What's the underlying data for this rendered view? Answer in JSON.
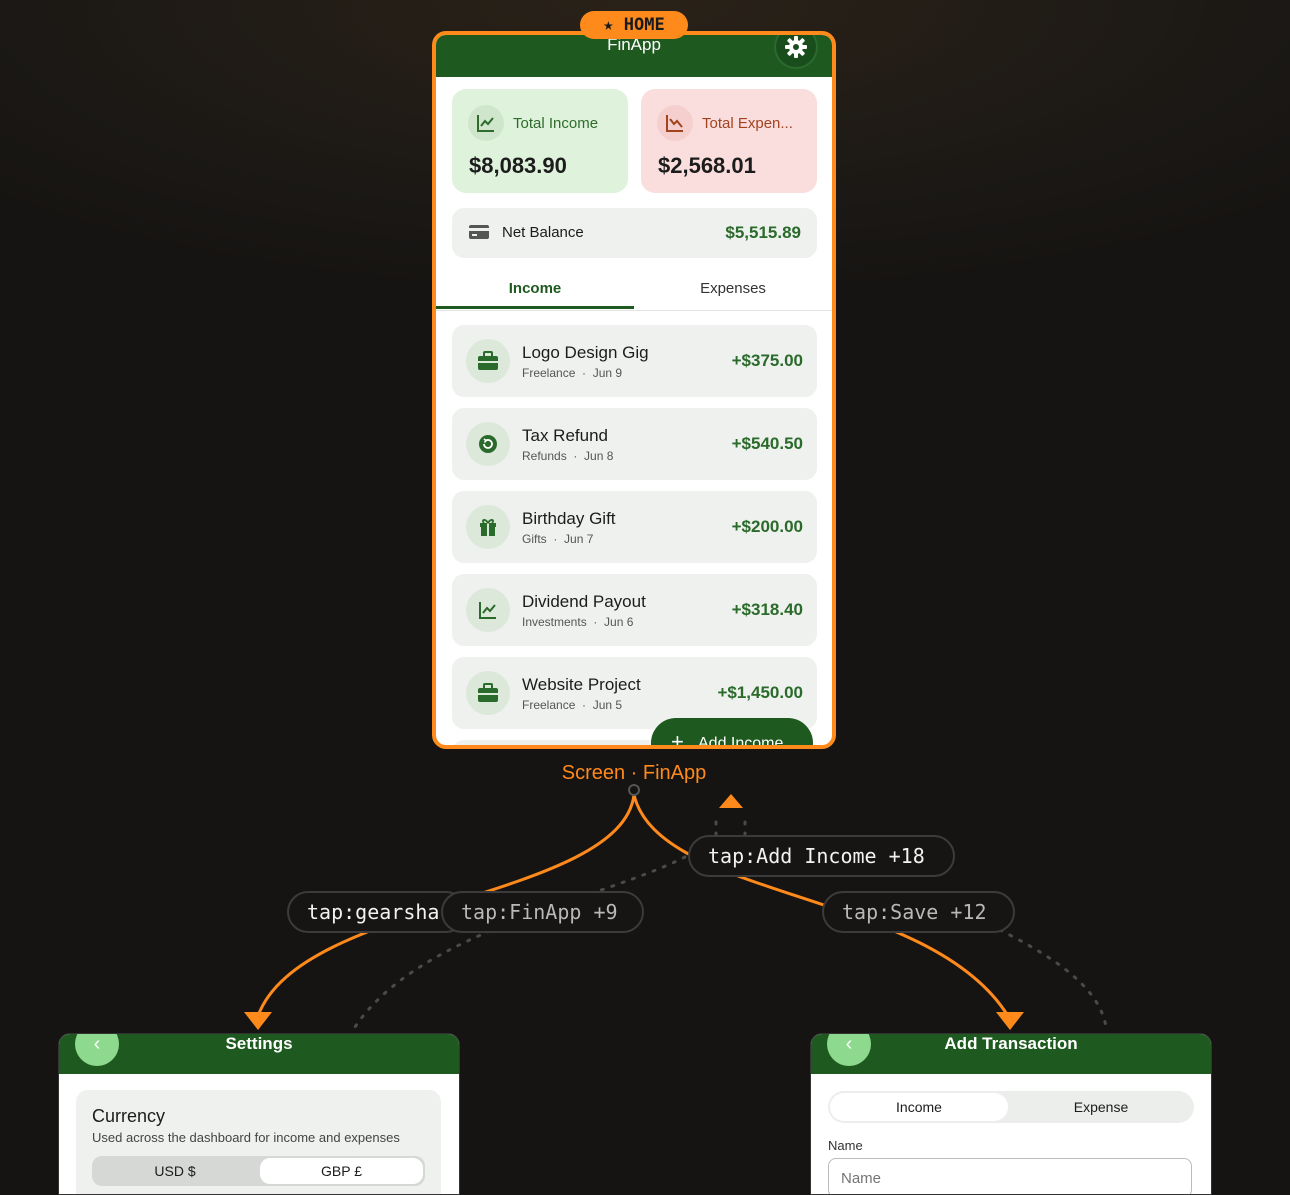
{
  "home_badge": "★ HOME",
  "home": {
    "app_title": "FinApp",
    "income_card": {
      "label": "Total Income",
      "amount": "$8,083.90"
    },
    "expense_card": {
      "label": "Total Expen...",
      "amount": "$2,568.01"
    },
    "net": {
      "label": "Net Balance",
      "amount": "$5,515.89"
    },
    "tabs": [
      "Income",
      "Expenses"
    ],
    "transactions": [
      {
        "name": "Logo Design Gig",
        "category": "Freelance",
        "date": "Jun 9",
        "amount": "+$375.00",
        "icon": "briefcase-icon"
      },
      {
        "name": "Tax Refund",
        "category": "Refunds",
        "date": "Jun 8",
        "amount": "+$540.50",
        "icon": "refund-icon"
      },
      {
        "name": "Birthday Gift",
        "category": "Gifts",
        "date": "Jun 7",
        "amount": "+$200.00",
        "icon": "gift-icon"
      },
      {
        "name": "Dividend Payout",
        "category": "Investments",
        "date": "Jun 6",
        "amount": "+$318.40",
        "icon": "chart-up-icon"
      },
      {
        "name": "Website Project",
        "category": "Freelance",
        "date": "Jun 5",
        "amount": "+$1,450.00",
        "icon": "briefcase-icon"
      }
    ],
    "sep": "·",
    "fab_label": "Add Income",
    "fab_plus": "+"
  },
  "screen_label": "Screen · FinApp",
  "edge_labels": {
    "gear": "tap:gearsha",
    "finapp": "tap:FinApp +9",
    "add_income": "tap:Add Income +18",
    "save": "tap:Save +12"
  },
  "settings": {
    "title": "Settings",
    "back": "‹",
    "card_title": "Currency",
    "card_desc": "Used across the dashboard for income and expenses",
    "options": [
      "USD  $",
      "GBP  £"
    ]
  },
  "add_transaction": {
    "title": "Add Transaction",
    "back": "‹",
    "options": [
      "Income",
      "Expense"
    ],
    "name_label": "Name",
    "name_placeholder": "Name"
  },
  "colors": {
    "accent": "#ff8a1c",
    "brand_green": "#1e5a20",
    "income_green": "#2a6a2a",
    "expense_red": "#a2431f"
  }
}
